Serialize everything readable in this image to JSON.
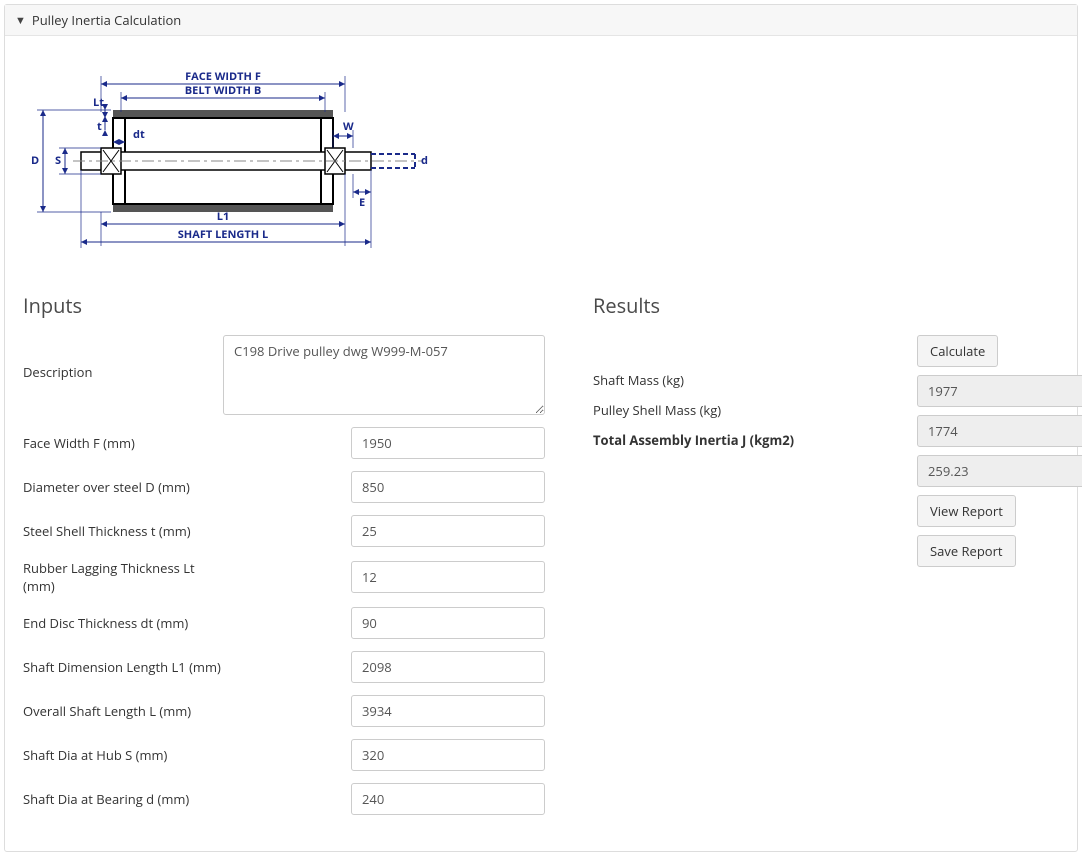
{
  "panel": {
    "title": "Pulley Inertia Calculation"
  },
  "diagram": {
    "labels": {
      "face_width": "FACE WIDTH F",
      "belt_width": "BELT WIDTH B",
      "Lt": "Lt",
      "t": "t",
      "dt": "dt",
      "D": "D",
      "S": "S",
      "W": "W",
      "d": "d",
      "E": "E",
      "L1": "L1",
      "shaft_length": "SHAFT LENGTH L"
    }
  },
  "inputs": {
    "heading": "Inputs",
    "description_label": "Description",
    "description_value": "C198 Drive pulley dwg W999-M-057",
    "fields": [
      {
        "label": "Face Width F (mm)",
        "value": "1950"
      },
      {
        "label": "Diameter over steel D (mm)",
        "value": "850"
      },
      {
        "label": "Steel Shell Thickness t (mm)",
        "value": "25"
      },
      {
        "label": "Rubber Lagging Thickness Lt (mm)",
        "value": "12"
      },
      {
        "label": "End Disc Thickness dt (mm)",
        "value": "90"
      },
      {
        "label": "Shaft Dimension Length L1 (mm)",
        "value": "2098"
      },
      {
        "label": "Overall Shaft Length L (mm)",
        "value": "3934"
      },
      {
        "label": "Shaft Dia at Hub S (mm)",
        "value": "320"
      },
      {
        "label": "Shaft Dia at Bearing d (mm)",
        "value": "240"
      }
    ]
  },
  "results": {
    "heading": "Results",
    "rows": [
      {
        "label": "Shaft Mass (kg)",
        "value": "1977",
        "bold": false
      },
      {
        "label": "Pulley Shell Mass (kg)",
        "value": "1774",
        "bold": false
      },
      {
        "label": "Total Assembly Inertia J (kgm2)",
        "value": "259.23",
        "bold": true
      }
    ],
    "actions": {
      "calculate": "Calculate",
      "view_report": "View Report",
      "save_report": "Save Report"
    }
  }
}
